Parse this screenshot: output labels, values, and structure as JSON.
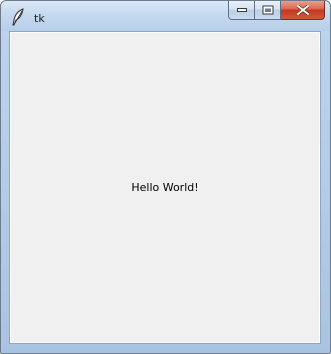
{
  "window": {
    "title": "tk",
    "app_icon": "tk-feather-icon",
    "caption_buttons": {
      "minimize_icon": "minimize-icon",
      "maximize_icon": "maximize-icon",
      "close_icon": "close-icon"
    }
  },
  "content": {
    "label": "Hello World!"
  },
  "colors": {
    "client_background": "#f0f0f0",
    "close_button": "#c8432b",
    "titlebar": "#c5d9ef"
  }
}
